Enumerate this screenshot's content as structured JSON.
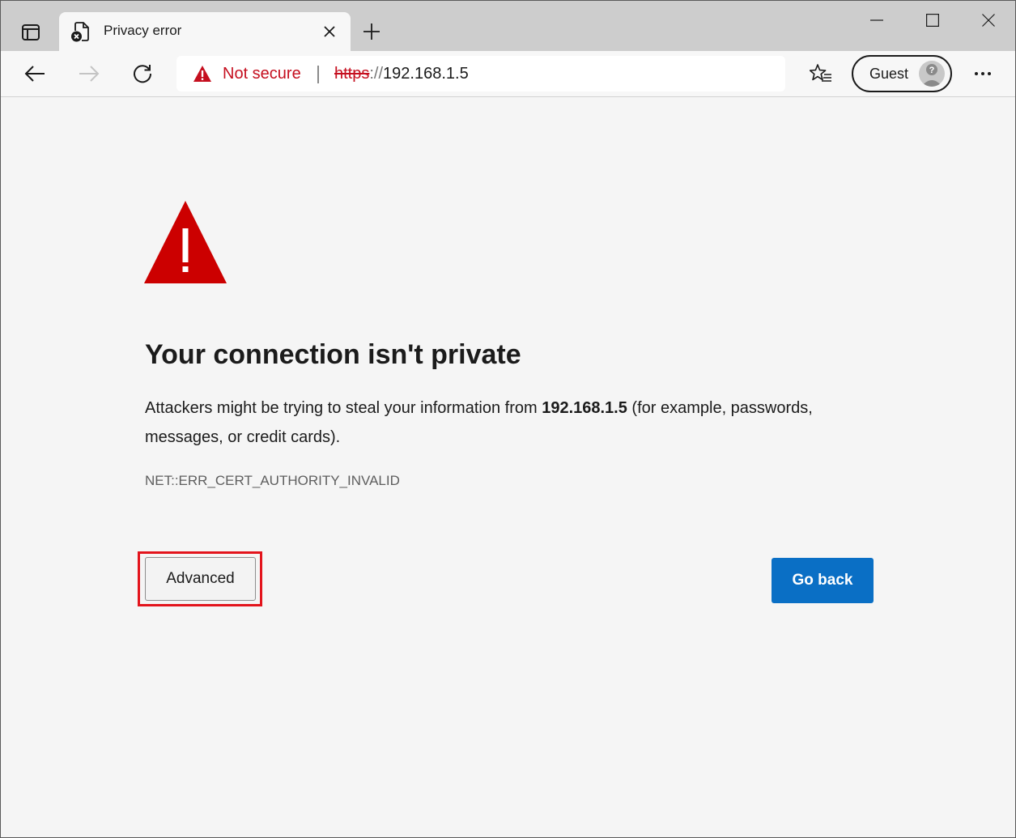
{
  "browser": {
    "tab": {
      "title": "Privacy error",
      "favicon": "error-document-icon"
    },
    "icons": {
      "tab_actions": "tab-actions-icon",
      "tab_close": "close-icon",
      "new_tab": "plus-icon",
      "minimize": "minimize-icon",
      "maximize": "maximize-icon",
      "close_window": "close-icon",
      "back": "arrow-left-icon",
      "forward": "arrow-right-icon",
      "refresh": "refresh-icon",
      "favorites": "favorites-star-icon",
      "more": "ellipsis-icon"
    },
    "address_bar": {
      "security_label": "Not secure",
      "url_scheme": "https",
      "url_separator": "://",
      "url_host": "192.168.1.5"
    },
    "profile": {
      "label": "Guest"
    },
    "forward_enabled": false
  },
  "page": {
    "heading": "Your connection isn't private",
    "description": {
      "before": "Attackers might be trying to steal your information from ",
      "host": "192.168.1.5",
      "after": " (for example, passwords, messages, or credit cards)."
    },
    "error_code": "NET::ERR_CERT_AUTHORITY_INVALID",
    "buttons": {
      "advanced": "Advanced",
      "go_back": "Go back"
    },
    "highlighted_element": "advanced-button"
  },
  "colors": {
    "warning_red": "#c50f1f",
    "icon_red": "#cc0000",
    "primary_blue": "#0a6fc5",
    "highlight_red": "#e3141c"
  }
}
